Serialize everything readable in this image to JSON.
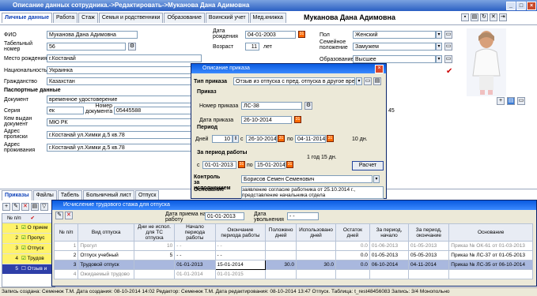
{
  "window": {
    "title": "Описание данных сотрудника.->Редактировать->Муканова Дана Адимовна"
  },
  "employee_name": "Муканова Дана Адимовна",
  "tabs": [
    "Личные данные",
    "Работа",
    "Стаж",
    "Семья и родственники",
    "Образование",
    "Воинский учет",
    "Мед.книжка"
  ],
  "form": {
    "fio_label": "ФИО",
    "fio": "Муканова Дана Адимовна",
    "tabnum_label": "Табельный номер",
    "tabnum": "56",
    "birthplace_label": "Место рождения",
    "birthplace": "г.Костанай",
    "nationality_label": "Национальность",
    "nationality": "Украинка",
    "citizenship_label": "Гражданство",
    "citizenship": "Казахстан",
    "passport_header": "Паспортные данные",
    "doc_label": "Документ",
    "doc": "временное удостоверение",
    "series_label": "Серия",
    "series": "ек",
    "docnum_label": "Номер документа",
    "docnum": "05445588",
    "issuer_label": "Кем выдан документ",
    "issuer": "МЮ РК",
    "reg_label": "Адрес прописки",
    "reg": "г.Костанай ул.Химки д.5 кв.78",
    "live_label": "Адрес проживания",
    "live": "г.Костанай ул.Химки д.5 кв.78",
    "birthdate_label": "Дата рождения",
    "birthdate": "04-01-2003",
    "age_label": "Возраст",
    "age": "11",
    "age_unit": "лет",
    "gender_label": "Пол",
    "gender": "Женский",
    "family_label": "Семейное положение",
    "family": "Замужем",
    "education_label": "Образование",
    "education": "Высшее",
    "right_tail": "45"
  },
  "vacation_dialog": {
    "title": "Описание приказа",
    "type_label": "Тип приказа",
    "type": "Отзыв из отпуска с пред. отпуска в другое время",
    "order_header": "Приказ",
    "ordernum_label": "Номер приказа",
    "ordernum": "ЛС-38",
    "orderdate_label": "Дата приказа",
    "orderdate": "26-10-2014",
    "period_header": "Период",
    "days_label": "Дней",
    "days": "10",
    "from_label": "с",
    "from": "26-10-2014",
    "to_label": "по",
    "to": "04-11-2014",
    "days_total": "10 дн.",
    "workperiod_header": "За период работы",
    "wp_from_label": "с",
    "wp_from": "01-01-2013",
    "wp_to_label": "по",
    "wp_to": "15-01-2014",
    "wp_len": "1 год 15 дн.",
    "calc_button": "Расчет",
    "control_label": "Контроль за исполнением",
    "control": "Борисов Семен Семенович",
    "basis_label": "Основание",
    "basis": "заявление согласие работника от 25.10.2014 г., представление начальника отдела"
  },
  "bottom_tabs": [
    "Приказы",
    "Файлы",
    "Табель",
    "Больничный лист",
    "Отпуск"
  ],
  "left_list": {
    "header_num": "№ п/п",
    "rows": [
      {
        "n": "1",
        "text": "О прием"
      },
      {
        "n": "2",
        "text": "Пропус"
      },
      {
        "n": "3",
        "text": "Отпуск"
      },
      {
        "n": "4",
        "text": "Трудов"
      },
      {
        "n": "5",
        "text": "Отзыв и"
      }
    ]
  },
  "stazh_dialog": {
    "title": "Исчисление трудового стажа для отпуска",
    "hire_label": "Дата приема на работу",
    "hire": "01-01-2013",
    "fire_label": "Дата увольнения",
    "fire": "- -",
    "columns": [
      "№ п/п",
      "Вид отпуска",
      "Дни не испол. для ТС отпуска",
      "Начало периода работы",
      "Окончание периода работы",
      "Положено дней",
      "Использовано дней",
      "Остаток дней",
      "За период, начало",
      "За период, окончание",
      "Основание"
    ],
    "rows": [
      [
        "1",
        "Прогул",
        "10",
        "- -",
        "- -",
        "",
        "",
        "0.0",
        "01-06-2013",
        "01-05-2013",
        "Приказ № ОК-61 от 01-03-2013"
      ],
      [
        "2",
        "Отпуск учебный",
        "5",
        "- -",
        "- -",
        "",
        "",
        "0.0",
        "01-05-2013",
        "05-05-2013",
        "Приказ № ЛС-37 от 01-05-2013"
      ],
      [
        "3",
        "Трудовой отпуск",
        "",
        "01-01-2013",
        "15-01-2014",
        "30.0",
        "30.0",
        "0.0",
        "06-10-2014",
        "04-11-2014",
        "Приказ № ЛС-35 от 06-10-2014"
      ],
      [
        "4",
        "Ожидаемый трудово",
        "",
        "01-01-2014",
        "01-01-2015",
        "",
        "",
        "",
        "",
        "",
        ""
      ]
    ]
  },
  "status_bar": "Запись создана: Семенюк Т.М.  Дата создания: 08-10-2014 14:02  Редактор: Семенюк Т.М.  Дата редактирования: 08-10-2014 13:47  Отпуск. Таблица: t_rest48456083  Запись: 3/4  Монопольно"
}
